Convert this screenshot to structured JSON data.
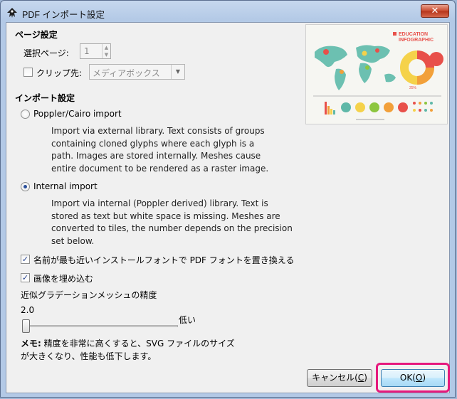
{
  "window": {
    "title": "PDF インポート設定",
    "close_glyph": "✕"
  },
  "page_settings": {
    "heading": "ページ設定",
    "select_page_label": "選択ページ:",
    "select_page_value": "1",
    "clip_label": "クリップ先:",
    "clip_checked": false,
    "clip_value": "メディアボックス"
  },
  "import_settings": {
    "heading": "インポート設定",
    "options": [
      {
        "label": "Poppler/Cairo import",
        "selected": false,
        "description": [
          "Import via external library. Text consists of groups",
          "containing cloned glyphs where each glyph is a",
          "path. Images are stored internally. Meshes cause",
          "entire document to be rendered as a raster image."
        ]
      },
      {
        "label": "Internal import",
        "selected": true,
        "description": [
          "Import via internal (Poppler derived) library. Text is",
          "stored as text but white space is missing. Meshes are",
          "converted to tiles, the number depends on the precision",
          "set below."
        ]
      }
    ],
    "replace_fonts_label": "名前が最も近いインストールフォントで PDF フォントを置き換える",
    "replace_fonts_checked": true,
    "embed_images_label": "画像を埋め込む",
    "embed_images_checked": true,
    "mesh_precision_label": "近似グラデーションメッシュの精度",
    "mesh_precision_value": "2.0",
    "mesh_precision_fraction": 0.0,
    "mesh_precision_level": "低い",
    "note_bold": "メモ:",
    "note_line1": " 精度を非常に高くすると、SVG ファイルのサイズ",
    "note_line2": "が大きくなり、性能も低下します。"
  },
  "preview": {
    "heading_line1": "EDUCATION",
    "heading_line2": "INFOGRAPHIC",
    "percent_label": "25%",
    "colors": {
      "teal": "#5fb8a8",
      "red": "#e8504a",
      "orange": "#f2a03a",
      "yellow": "#f5d24a",
      "green": "#8dc63f"
    }
  },
  "buttons": {
    "cancel_label": "キャンセル(",
    "cancel_key": "C",
    "cancel_end": ")",
    "ok_label": "OK(",
    "ok_key": "O",
    "ok_end": ")"
  },
  "colors": {
    "highlight": "#e6197d"
  }
}
